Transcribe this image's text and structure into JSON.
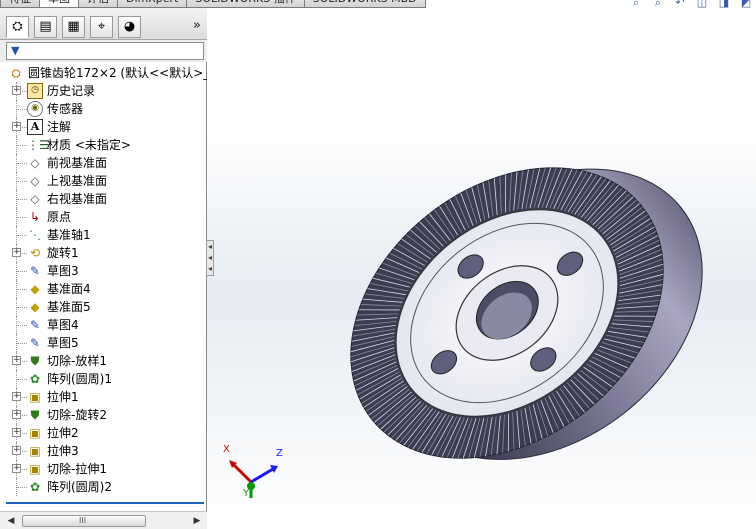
{
  "top_tabs": [
    {
      "label": "特征",
      "active": false
    },
    {
      "label": "草图",
      "active": true
    },
    {
      "label": "评估",
      "active": false
    },
    {
      "label": "DimXpert",
      "active": false
    },
    {
      "label": "SOLIDWORKS 插件",
      "active": false
    },
    {
      "label": "SOLIDWORKS MBD",
      "active": false
    }
  ],
  "view_tools": [
    "zoom-fit-icon",
    "zoom-area-icon",
    "previous-view-icon",
    "section-view-icon",
    "view-orientation-icon",
    "display-style-icon"
  ],
  "feature_manager": {
    "tabs": [
      {
        "name": "featuremanager-tab",
        "icon": "feature-tree-icon",
        "glyph": "⛭"
      },
      {
        "name": "propertymanager-tab",
        "icon": "property-manager-icon",
        "glyph": "▤"
      },
      {
        "name": "configurationmanager-tab",
        "icon": "configuration-manager-icon",
        "glyph": "▦"
      },
      {
        "name": "dimxpertmanager-tab",
        "icon": "dimxpert-icon",
        "glyph": "⌖"
      },
      {
        "name": "displaymanager-tab",
        "icon": "display-manager-icon",
        "glyph": "◕"
      }
    ],
    "expand_glyph": "»",
    "filter_glyph": "▼",
    "tree": [
      {
        "label": "圆锥齿轮172×2  (默认<<默认>_",
        "icon": "part-icon",
        "glyph": "⛭",
        "cls": "ic-part",
        "expander": false,
        "level": 0
      },
      {
        "label": "历史记录",
        "icon": "history-icon",
        "glyph": "◷",
        "cls": "ic-history",
        "expander": true,
        "level": 1
      },
      {
        "label": "传感器",
        "icon": "sensor-icon",
        "glyph": "◉",
        "cls": "ic-sensor",
        "expander": false,
        "level": 1
      },
      {
        "label": "注解",
        "icon": "annotations-icon",
        "glyph": "A",
        "cls": "ic-annot",
        "expander": true,
        "level": 1
      },
      {
        "label": "材质 <未指定>",
        "icon": "material-icon",
        "glyph": "⋮☰",
        "cls": "ic-material",
        "expander": false,
        "level": 1
      },
      {
        "label": "前视基准面",
        "icon": "plane-icon",
        "glyph": "◇",
        "cls": "ic-plane",
        "expander": false,
        "level": 1
      },
      {
        "label": "上视基准面",
        "icon": "plane-icon",
        "glyph": "◇",
        "cls": "ic-plane",
        "expander": false,
        "level": 1
      },
      {
        "label": "右视基准面",
        "icon": "plane-icon",
        "glyph": "◇",
        "cls": "ic-plane",
        "expander": false,
        "level": 1
      },
      {
        "label": "原点",
        "icon": "origin-icon",
        "glyph": "↳",
        "cls": "ic-origin",
        "expander": false,
        "level": 1
      },
      {
        "label": "基准轴1",
        "icon": "axis-icon",
        "glyph": "⋱",
        "cls": "ic-axis",
        "expander": false,
        "level": 1
      },
      {
        "label": "旋转1",
        "icon": "revolve-icon",
        "glyph": "⟲",
        "cls": "ic-revolve",
        "expander": true,
        "level": 1
      },
      {
        "label": "草图3",
        "icon": "sketch-icon",
        "glyph": "✎",
        "cls": "ic-sketch",
        "expander": false,
        "level": 1
      },
      {
        "label": "基准面4",
        "icon": "reference-plane-icon",
        "glyph": "◆",
        "cls": "ic-plane-yellow",
        "expander": false,
        "level": 1
      },
      {
        "label": "基准面5",
        "icon": "reference-plane-icon",
        "glyph": "◆",
        "cls": "ic-plane-yellow",
        "expander": false,
        "level": 1
      },
      {
        "label": "草图4",
        "icon": "sketch-icon",
        "glyph": "✎",
        "cls": "ic-sketch",
        "expander": false,
        "level": 1
      },
      {
        "label": "草图5",
        "icon": "sketch-icon",
        "glyph": "✎",
        "cls": "ic-sketch",
        "expander": false,
        "level": 1
      },
      {
        "label": "切除-放样1",
        "icon": "cut-loft-icon",
        "glyph": "⛊",
        "cls": "ic-cut",
        "expander": true,
        "level": 1
      },
      {
        "label": "阵列(圆周)1",
        "icon": "circular-pattern-icon",
        "glyph": "✿",
        "cls": "ic-pattern",
        "expander": false,
        "level": 1
      },
      {
        "label": "拉伸1",
        "icon": "extrude-icon",
        "glyph": "▣",
        "cls": "ic-extrude",
        "expander": true,
        "level": 1
      },
      {
        "label": "切除-旋转2",
        "icon": "cut-revolve-icon",
        "glyph": "⛊",
        "cls": "ic-cut",
        "expander": true,
        "level": 1
      },
      {
        "label": "拉伸2",
        "icon": "extrude-icon",
        "glyph": "▣",
        "cls": "ic-extrude",
        "expander": true,
        "level": 1
      },
      {
        "label": "拉伸3",
        "icon": "extrude-icon",
        "glyph": "▣",
        "cls": "ic-extrude",
        "expander": true,
        "level": 1
      },
      {
        "label": "切除-拉伸1",
        "icon": "cut-extrude-icon",
        "glyph": "▣",
        "cls": "ic-extrude",
        "expander": true,
        "level": 1
      },
      {
        "label": "阵列(圆周)2",
        "icon": "circular-pattern-icon",
        "glyph": "✿",
        "cls": "ic-pattern",
        "expander": false,
        "level": 1
      }
    ],
    "scroll_left_glyph": "◀",
    "scroll_right_glyph": "▶",
    "scroll_grip_glyph": "III"
  },
  "triad": {
    "x_label": "X",
    "y_label": "Y",
    "z_label": "Z",
    "colors": {
      "x": "#cc0000",
      "y": "#009900",
      "z": "#1a1aff"
    }
  },
  "colors": {
    "gear_body": "#5f5e7c",
    "gear_face": "#f2f3f8",
    "gear_teeth": "#3d3d52",
    "selection_blue": "#1f5fc0"
  }
}
